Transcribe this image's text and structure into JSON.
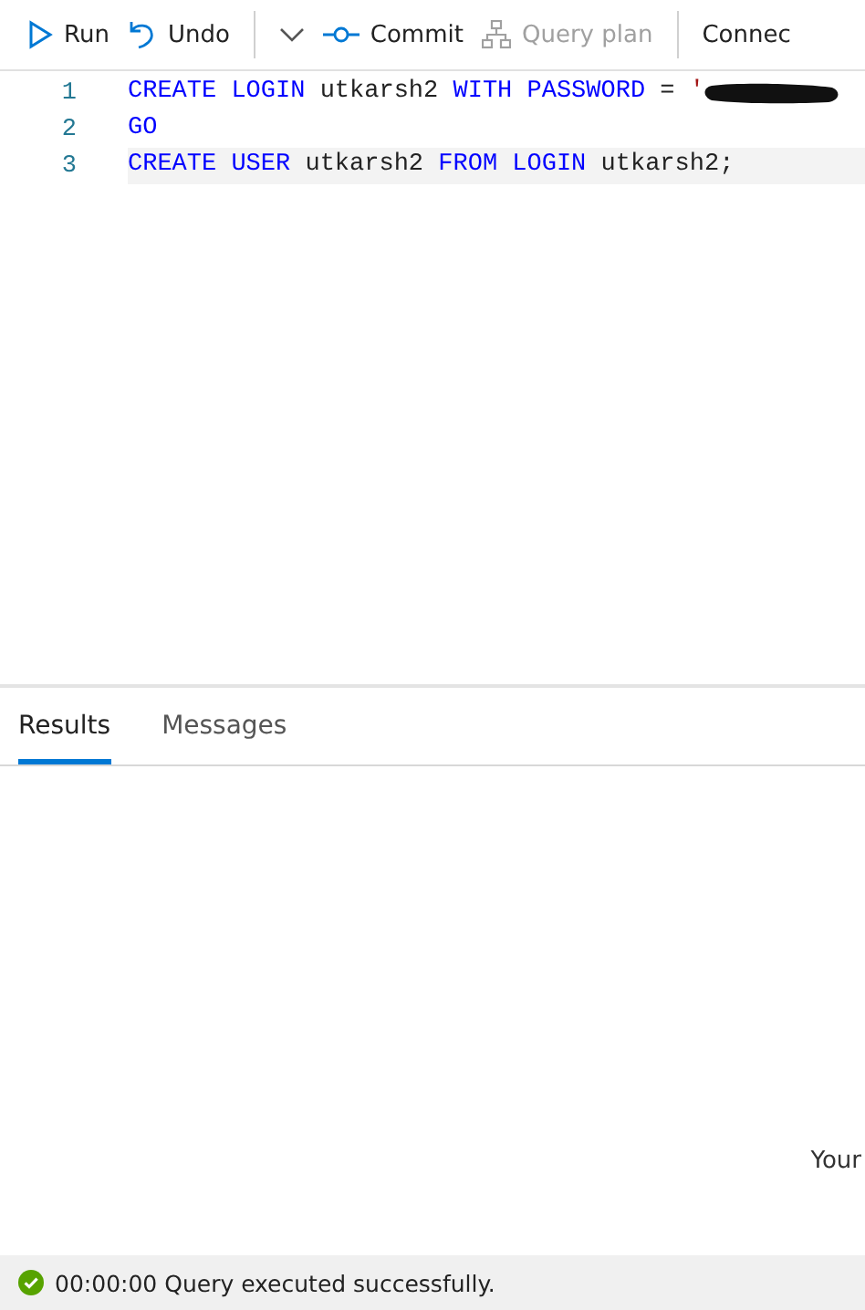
{
  "toolbar": [
    {
      "kind": "run",
      "label": "Run",
      "disabled": false
    },
    {
      "kind": "undo",
      "label": "Undo",
      "disabled": false
    },
    {
      "kind": "separator"
    },
    {
      "kind": "dropdown"
    },
    {
      "kind": "commit",
      "label": "Commit",
      "disabled": false
    },
    {
      "kind": "plan",
      "label": "Query plan",
      "disabled": true
    },
    {
      "kind": "separator"
    },
    {
      "kind": "text",
      "label": "Connec",
      "disabled": false
    }
  ],
  "editor": {
    "lines": [
      {
        "number": "1",
        "current": false,
        "redacted": true,
        "tokens": [
          {
            "kind": "keyword",
            "text": "CREATE LOGIN "
          },
          {
            "kind": "identifier",
            "text": "utkarsh2 "
          },
          {
            "kind": "keyword",
            "text": "WITH PASSWORD "
          },
          {
            "kind": "identifier",
            "text": "= "
          },
          {
            "kind": "string",
            "text": "'"
          }
        ]
      },
      {
        "number": "2",
        "current": false,
        "tokens": [
          {
            "kind": "keyword",
            "text": "GO"
          }
        ]
      },
      {
        "number": "3",
        "current": true,
        "tokens": [
          {
            "kind": "keyword",
            "text": "CREATE USER "
          },
          {
            "kind": "identifier",
            "text": "utkarsh2 "
          },
          {
            "kind": "keyword",
            "text": "FROM LOGIN "
          },
          {
            "kind": "identifier",
            "text": "utkarsh2;"
          }
        ]
      }
    ]
  },
  "tabs": [
    {
      "label": "Results",
      "selected": true
    },
    {
      "label": "Messages",
      "selected": false
    }
  ],
  "results": {
    "text": "Your"
  },
  "status_bar": {
    "text": "00:00:00 Query executed successfully."
  }
}
